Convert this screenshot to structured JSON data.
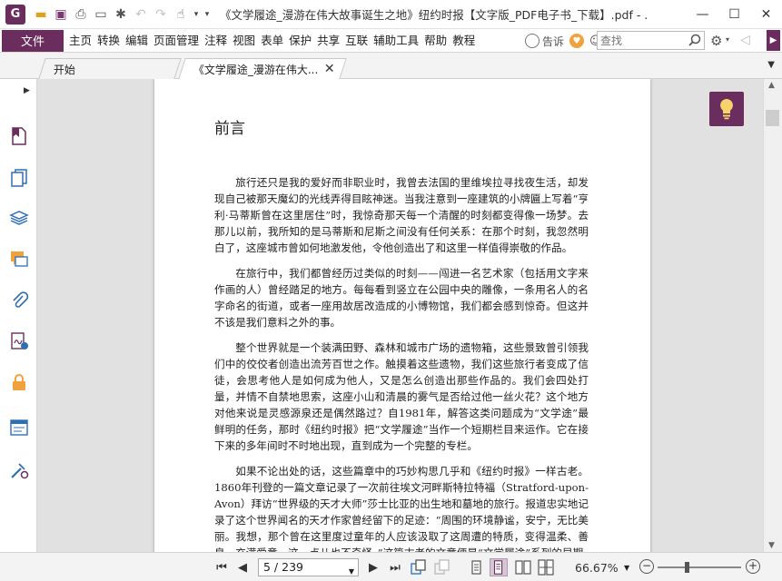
{
  "window": {
    "title": "《文学履途_漫游在伟大故事诞生之地》纽约时报【文字版_PDF电子书_下载】.pdf - ...",
    "logo_letter": "G"
  },
  "menu": {
    "file": "文件",
    "items": [
      "主页",
      "转换",
      "编辑",
      "页面管理",
      "注释",
      "视图",
      "表单",
      "保护",
      "共享",
      "互联",
      "辅助工具",
      "帮助",
      "教程"
    ],
    "tell_me": "告诉",
    "search_placeholder": "查找"
  },
  "tabs": [
    {
      "label": "开始"
    },
    {
      "label": "《文学履途_漫游在伟大..."
    }
  ],
  "document": {
    "heading": "前言",
    "paragraphs": [
      "旅行还只是我的爱好而非职业时，我曾去法国的里维埃拉寻找夜生活，却发现自己被那天魔幻的光线弄得目眩神迷。当我注意到一座建筑的小牌匾上写着“亨利·马蒂斯曾在这里居住”时，我惊奇那天每一个清醒的时刻都变得像一场梦。去那儿以前，我所知的是马蒂斯和尼斯之间没有任何关系：在那个时刻，我忽然明白了，这座城市曾如何地激发他，令他创造出了和这里一样值得崇敬的作品。",
      "在旅行中，我们都曾经历过类似的时刻——闯进一名艺术家（包括用文字来作画的人）曾经踏足的地方。每每看到竖立在公园中央的雕像，一条用名人的名字命名的街道，或者一座用故居改造成的小博物馆，我们都会感到惊奇。但这并不该是我们意料之外的事。",
      "整个世界就是一个装满田野、森林和城市广场的遗物箱，这些景致曾引领我们中的佼佼者创造出流芳百世之作。触摸着这些遗物，我们这些旅行者变成了信徒，会思考他人是如何成为他人，又是怎么创造出那些作品的。我们会四处打量，并情不自禁地思索，这座小山和清晨的雾气是否给过他一丝火花？这个地方对他来说是灵感源泉还是偶然路过？自1981年，解答这类问题成为“文学途”最鲜明的任务，那时《纽约时报》把“文学履途”当作一个短期栏目来运作。它在接下来的多年间时不时地出现，直到成为一个完整的专栏。",
      "如果不论出处的话，这些篇章中的巧妙构思几乎和《纽约时报》一样古老。1860年刊登的一篇文章记录了一次前往埃文河畔斯特拉特福（Stratford-upon-Avon）拜访“世界级的天才大师”莎士比亚的出生地和墓地的旅行。报道忠实地记录了这个世界闻名的天才作家曾经留下的足迹：“周围的环境静谧，安宁，无比美丽。我想，那个曾在这里度过童年的人应该汲取了这周遭的特质，变得温柔、善良、充满爱意。这一点儿也不奇怪。”这篇古老的文章便是“文学履途”系列的早期"
    ]
  },
  "status": {
    "page_display": "5 / 239",
    "zoom": "66.67%",
    "zoom_level_percent": 66.67
  },
  "colors": {
    "brand": "#6b2d5e",
    "accent_orange": "#f2a23c"
  }
}
